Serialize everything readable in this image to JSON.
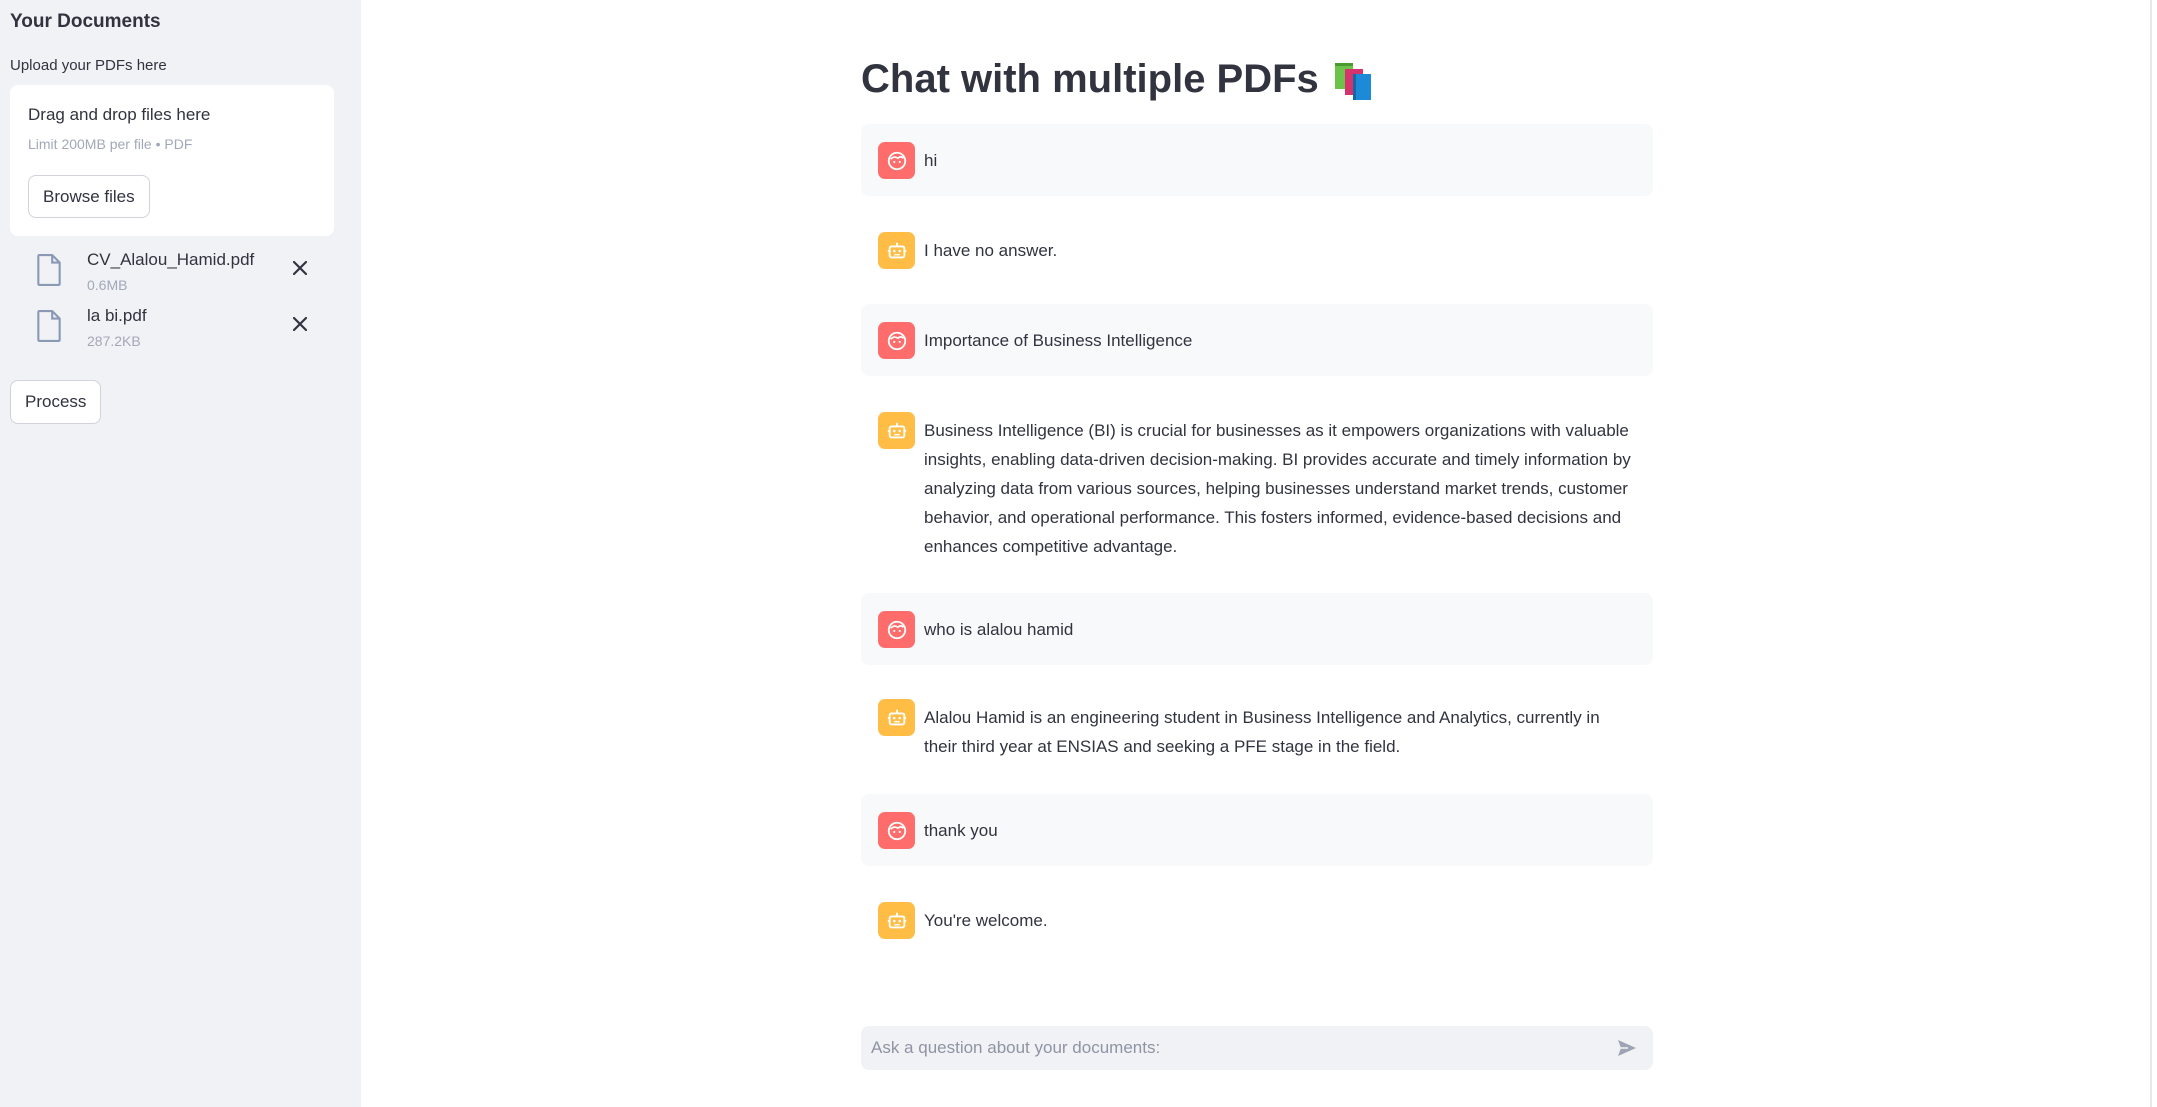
{
  "sidebar": {
    "title": "Your Documents",
    "upload_label": "Upload your PDFs here",
    "dropzone": {
      "main_text": "Drag and drop files here",
      "sub_text": "Limit 200MB per file • PDF",
      "browse_label": "Browse files"
    },
    "files": [
      {
        "name": "CV_Alalou_Hamid.pdf",
        "size": "0.6MB",
        "icon": "file-icon",
        "remove_icon": "close-icon"
      },
      {
        "name": "la bi.pdf",
        "size": "287.2KB",
        "icon": "file-icon",
        "remove_icon": "close-icon"
      }
    ],
    "process_label": "Process"
  },
  "main": {
    "title": "Chat with multiple PDFs",
    "title_icon": "books-icon",
    "messages": [
      {
        "role": "user",
        "avatar": "user-face-icon",
        "text": "hi"
      },
      {
        "role": "bot",
        "avatar": "robot-icon",
        "text": "I have no answer."
      },
      {
        "role": "user",
        "avatar": "user-face-icon",
        "text": "Importance of Business Intelligence"
      },
      {
        "role": "bot",
        "avatar": "robot-icon",
        "text": "Business Intelligence (BI) is crucial for businesses as it empowers organizations with valuable insights, enabling data-driven decision-making. BI provides accurate and timely information by analyzing data from various sources, helping businesses understand market trends, customer behavior, and operational performance. This fosters informed, evidence-based decisions and enhances competitive advantage."
      },
      {
        "role": "user",
        "avatar": "user-face-icon",
        "text": "who is alalou hamid"
      },
      {
        "role": "bot",
        "avatar": "robot-icon",
        "text": "Alalou Hamid is an engineering student in Business Intelligence and Analytics, currently in their third year at ENSIAS and seeking a PFE stage in the field."
      },
      {
        "role": "user",
        "avatar": "user-face-icon",
        "text": "thank you"
      },
      {
        "role": "bot",
        "avatar": "robot-icon",
        "text": "You're welcome."
      }
    ],
    "chat_input": {
      "placeholder": "Ask a question about your documents:",
      "value": "",
      "send_icon": "send-icon"
    }
  },
  "colors": {
    "sidebar_bg": "#f0f2f6",
    "user_avatar": "#ff6c6c",
    "bot_avatar": "#ffbd45",
    "user_msg_bg": "#f8f9fb",
    "text": "#31333f"
  }
}
